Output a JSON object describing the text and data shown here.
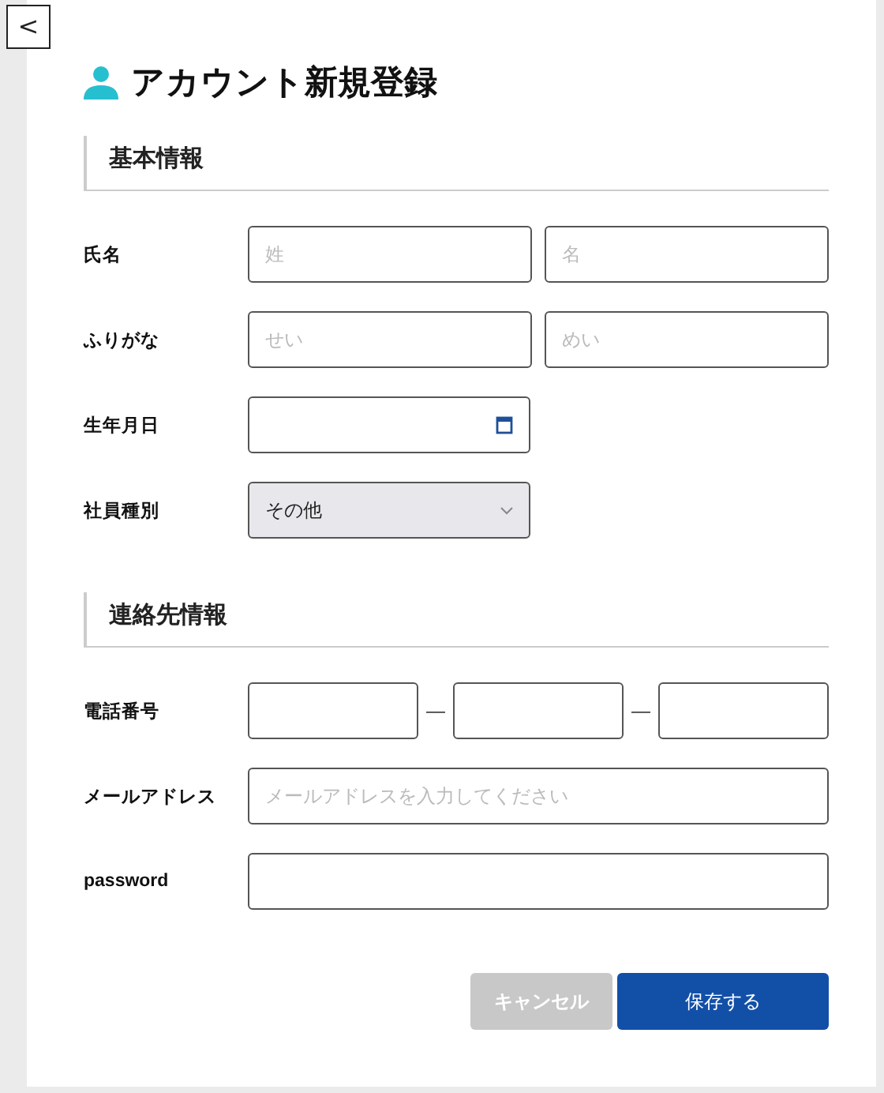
{
  "back_button": {
    "label": "<"
  },
  "title": "アカウント新規登録",
  "sections": [
    {
      "heading": "基本情報",
      "rows": [
        {
          "kind": "pair",
          "label": "氏名",
          "fields": [
            {
              "placeholder": "姓"
            },
            {
              "placeholder": "名"
            }
          ]
        },
        {
          "kind": "pair",
          "label": "ふりがな",
          "fields": [
            {
              "placeholder": "せい"
            },
            {
              "placeholder": "めい"
            }
          ]
        },
        {
          "kind": "date",
          "label": "生年月日"
        },
        {
          "kind": "select",
          "label": "社員種別",
          "value": "その他"
        }
      ]
    },
    {
      "heading": "連絡先情報",
      "rows": [
        {
          "kind": "phone",
          "label": "電話番号",
          "separator": "—"
        },
        {
          "kind": "text",
          "label": "メールアドレス",
          "placeholder": "メールアドレスを入力してください"
        },
        {
          "kind": "text",
          "label": "password"
        }
      ]
    }
  ],
  "buttons": [
    {
      "label": "キャンセル",
      "kind": "cancel",
      "disabled": true
    },
    {
      "label": "保存する",
      "kind": "save",
      "disabled": false
    }
  ]
}
